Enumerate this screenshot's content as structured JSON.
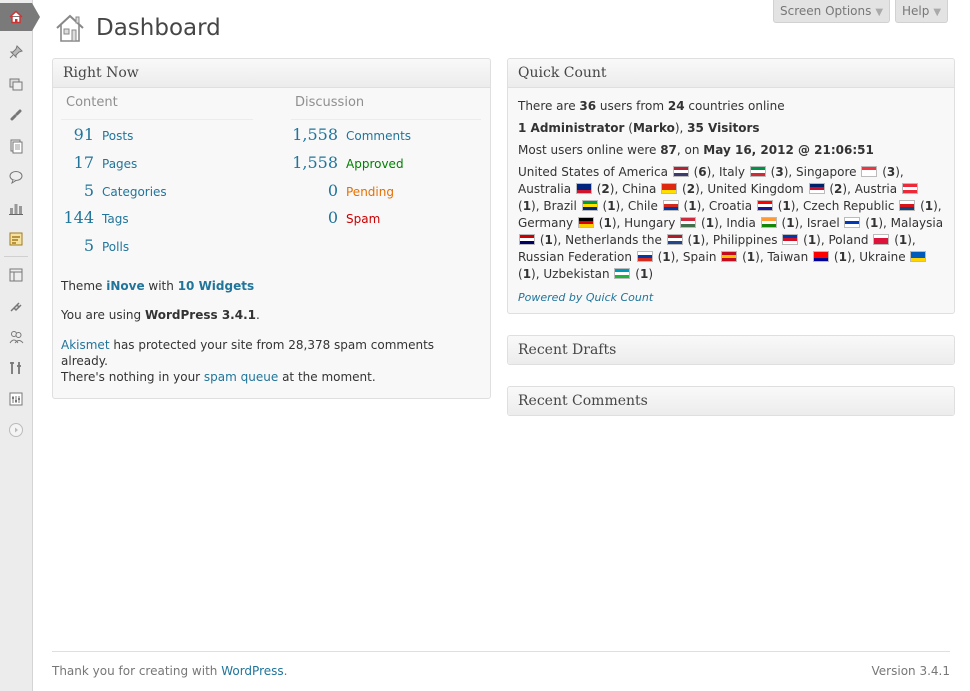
{
  "page": {
    "title": "Dashboard"
  },
  "screen_options": {
    "label": "Screen Options",
    "help_label": "Help"
  },
  "sidebar": {
    "icons": [
      "home-icon",
      "pin-icon",
      "media-icon",
      "links-icon",
      "pages-icon",
      "comments-icon",
      "stats-icon",
      "polls-icon",
      "appearance-icon",
      "plugins-icon",
      "users-icon",
      "tools-icon",
      "settings-icon",
      "collapse-icon"
    ]
  },
  "right_now": {
    "title": "Right Now",
    "content_heading": "Content",
    "discussion_heading": "Discussion",
    "content": [
      {
        "num": "91",
        "label": "Posts"
      },
      {
        "num": "17",
        "label": "Pages"
      },
      {
        "num": "5",
        "label": "Categories"
      },
      {
        "num": "144",
        "label": "Tags"
      },
      {
        "num": "5",
        "label": "Polls"
      }
    ],
    "discussion": [
      {
        "num": "1,558",
        "label": "Comments",
        "color": "#21759b"
      },
      {
        "num": "1,558",
        "label": "Approved",
        "color": "#008000"
      },
      {
        "num": "0",
        "label": "Pending",
        "color": "#e66f00"
      },
      {
        "num": "0",
        "label": "Spam",
        "color": "#cc0000"
      }
    ],
    "theme_prefix": "Theme ",
    "theme_name": "iNove",
    "theme_with": " with ",
    "theme_widgets": "10 Widgets",
    "version_prefix": "You are using ",
    "version_name": "WordPress 3.4.1",
    "version_suffix": ".",
    "akismet_link": "Akismet",
    "akismet_text": " has protected your site from 28,378 spam comments",
    "akismet_text2": "already.",
    "spam_prefix": "There's nothing in your ",
    "spam_link": "spam queue",
    "spam_suffix": " at the moment."
  },
  "quick_count": {
    "title": "Quick Count",
    "line1_a": "There are ",
    "line1_users": "36",
    "line1_b": " users from ",
    "line1_countries": "24",
    "line1_c": " countries online",
    "admins_count": "1 Administrator",
    "admin_name": "Marko",
    "visitors": "35 Visitors",
    "most_a": "Most users online were ",
    "most_num": "87",
    "most_b": ", on ",
    "most_date": "May 16, 2012 @ 21:06:51",
    "countries": [
      {
        "name": "United States of America",
        "count": "6",
        "flag": [
          "#b22234",
          "#ffffff",
          "#3c3b6e"
        ]
      },
      {
        "name": "Italy",
        "count": "3",
        "flag": [
          "#009246",
          "#ffffff",
          "#ce2b37"
        ]
      },
      {
        "name": "Singapore",
        "count": "3",
        "flag": [
          "#ef3340",
          "#ffffff",
          "#ffffff"
        ]
      },
      {
        "name": "Australia",
        "count": "2",
        "flag": [
          "#00247d",
          "#00247d",
          "#cf142b"
        ]
      },
      {
        "name": "China",
        "count": "2",
        "flag": [
          "#de2910",
          "#de2910",
          "#ffde00"
        ]
      },
      {
        "name": "United Kingdom",
        "count": "2",
        "flag": [
          "#012169",
          "#c8102e",
          "#ffffff"
        ]
      },
      {
        "name": "Austria",
        "count": "1",
        "flag": [
          "#ed2939",
          "#ffffff",
          "#ed2939"
        ]
      },
      {
        "name": "Brazil",
        "count": "1",
        "flag": [
          "#009c3b",
          "#ffdf00",
          "#002776"
        ]
      },
      {
        "name": "Chile",
        "count": "1",
        "flag": [
          "#ffffff",
          "#d52b1e",
          "#0039a6"
        ]
      },
      {
        "name": "Croatia",
        "count": "1",
        "flag": [
          "#ff0000",
          "#ffffff",
          "#171796"
        ]
      },
      {
        "name": "Czech Republic",
        "count": "1",
        "flag": [
          "#ffffff",
          "#d7141a",
          "#11457e"
        ]
      },
      {
        "name": "Germany",
        "count": "1",
        "flag": [
          "#000000",
          "#dd0000",
          "#ffce00"
        ]
      },
      {
        "name": "Hungary",
        "count": "1",
        "flag": [
          "#cd2a3e",
          "#ffffff",
          "#436f4d"
        ]
      },
      {
        "name": "India",
        "count": "1",
        "flag": [
          "#ff9933",
          "#ffffff",
          "#138808"
        ]
      },
      {
        "name": "Israel",
        "count": "1",
        "flag": [
          "#ffffff",
          "#0038b8",
          "#ffffff"
        ]
      },
      {
        "name": "Malaysia",
        "count": "1",
        "flag": [
          "#cc0001",
          "#ffffff",
          "#010066"
        ]
      },
      {
        "name": "Netherlands the",
        "count": "1",
        "flag": [
          "#ae1c28",
          "#ffffff",
          "#21468b"
        ]
      },
      {
        "name": "Philippines",
        "count": "1",
        "flag": [
          "#0038a8",
          "#ce1126",
          "#ffffff"
        ]
      },
      {
        "name": "Poland",
        "count": "1",
        "flag": [
          "#ffffff",
          "#dc143c",
          "#dc143c"
        ]
      },
      {
        "name": "Russian Federation",
        "count": "1",
        "flag": [
          "#ffffff",
          "#0039a6",
          "#d52b1e"
        ]
      },
      {
        "name": "Spain",
        "count": "1",
        "flag": [
          "#c60b1e",
          "#ffc400",
          "#c60b1e"
        ]
      },
      {
        "name": "Taiwan",
        "count": "1",
        "flag": [
          "#fe0000",
          "#fe0000",
          "#000095"
        ]
      },
      {
        "name": "Ukraine",
        "count": "1",
        "flag": [
          "#005bbb",
          "#005bbb",
          "#ffd500"
        ]
      },
      {
        "name": "Uzbekistan",
        "count": "1",
        "flag": [
          "#0099b5",
          "#ffffff",
          "#1eb53a"
        ]
      }
    ],
    "powered_by": "Powered by Quick Count"
  },
  "recent_drafts": {
    "title": "Recent Drafts"
  },
  "recent_comments": {
    "title": "Recent Comments"
  },
  "footer": {
    "left_prefix": "Thank you for creating with ",
    "left_link": "WordPress",
    "left_suffix": ".",
    "version": "Version 3.4.1"
  }
}
